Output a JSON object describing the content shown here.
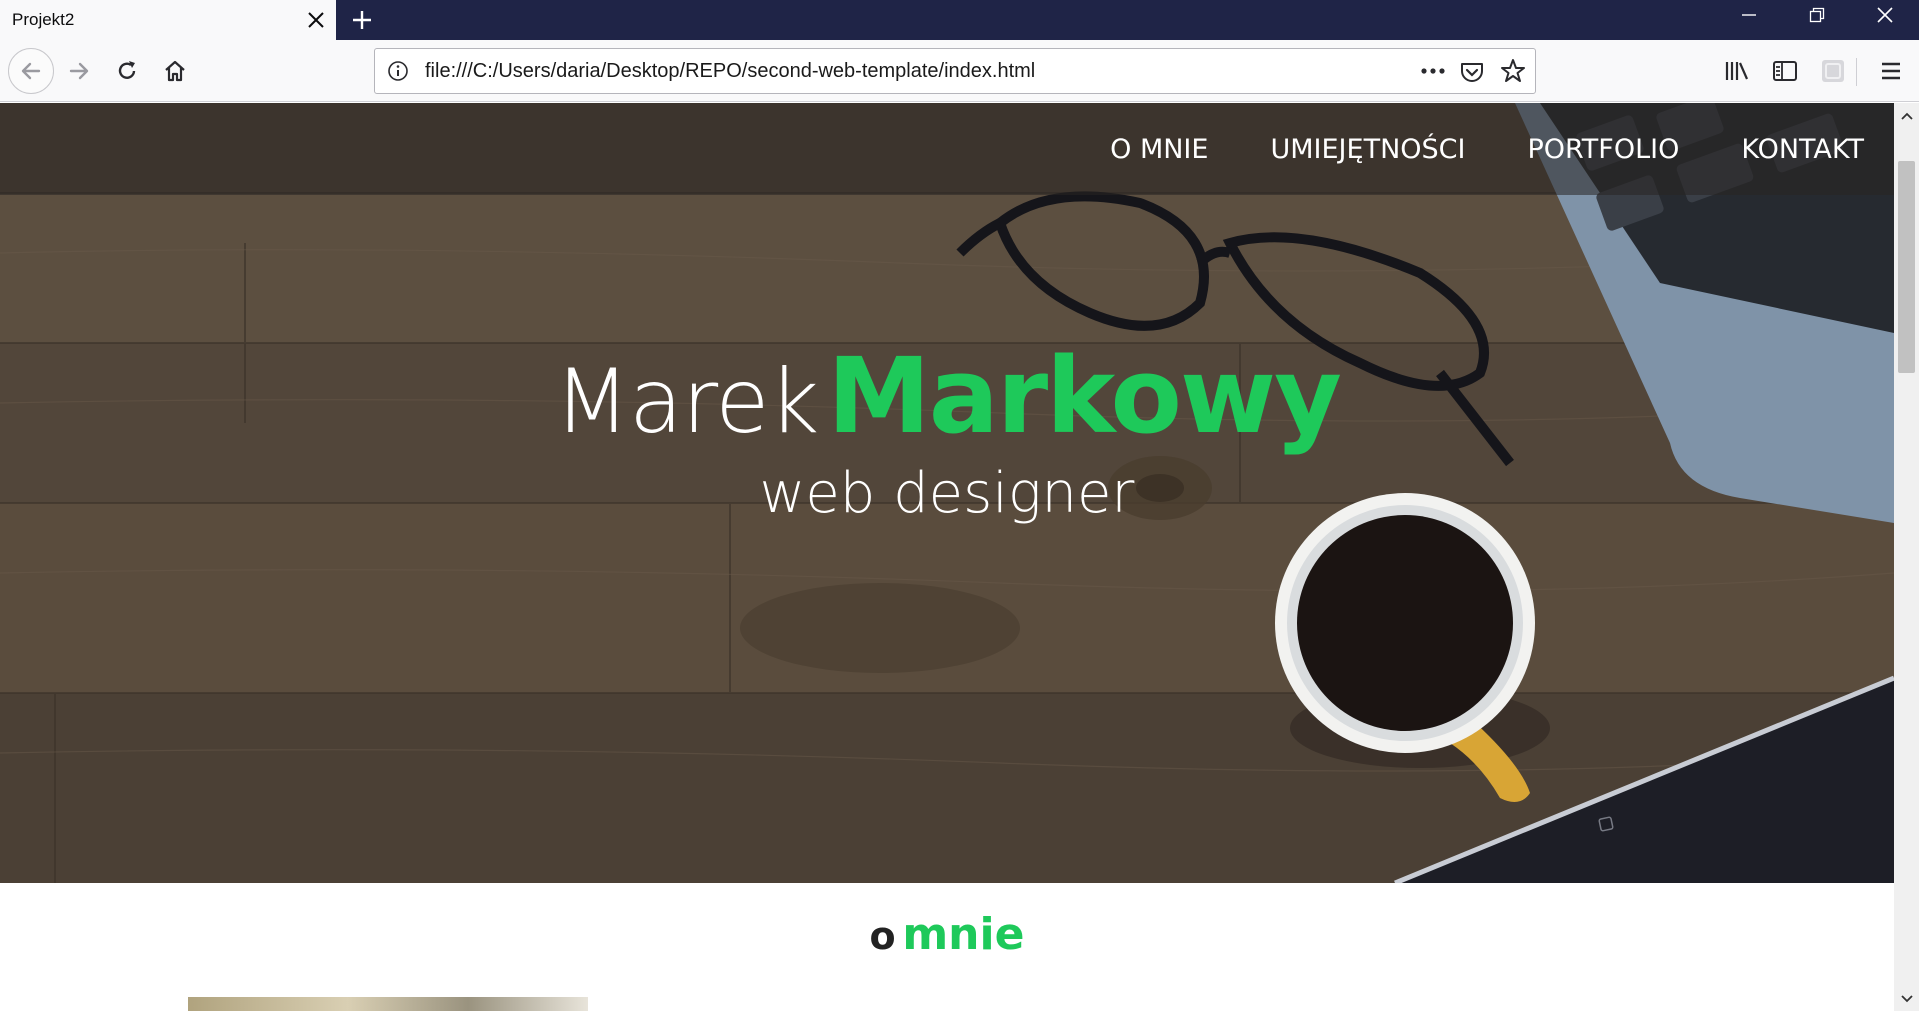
{
  "browser": {
    "tab_title": "Projekt2",
    "url": "file:///C:/Users/daria/Desktop/REPO/second-web-template/index.html",
    "icons": [
      "close-icon",
      "plus-icon",
      "minimize-icon",
      "restore-icon",
      "back-icon",
      "forward-icon",
      "reload-icon",
      "home-icon",
      "info-icon",
      "more-icon",
      "pocket-icon",
      "star-icon",
      "library-icon",
      "sidebar-icon",
      "extension-icon",
      "hamburger-icon"
    ]
  },
  "site": {
    "menu": [
      {
        "label": "O MNIE"
      },
      {
        "label": "UMIEJĘTNOŚCI"
      },
      {
        "label": "PORTFOLIO"
      },
      {
        "label": "KONTAKT"
      }
    ],
    "hero": {
      "first_name": "Marek",
      "last_name": "Markowy",
      "subtitle": "web designer"
    },
    "about": {
      "heading_prefix": "o",
      "heading_accent": "mnie"
    },
    "colors": {
      "accent": "#1ec95a",
      "tabbar": "#1f2447"
    }
  }
}
